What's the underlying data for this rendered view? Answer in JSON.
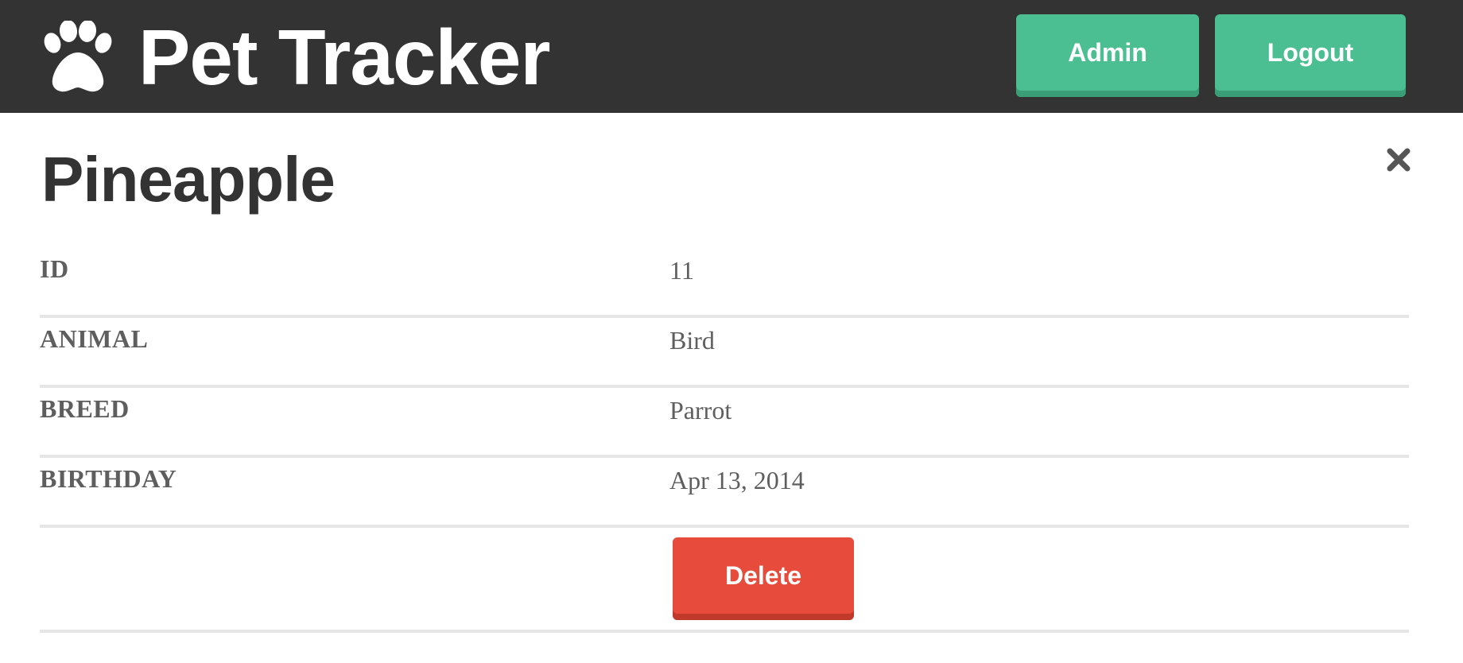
{
  "header": {
    "brand_icon": "paw-icon",
    "title": "Pet Tracker",
    "admin_label": "Admin",
    "logout_label": "Logout",
    "background_color": "#333333",
    "button_color": "#4bbf92"
  },
  "pet": {
    "name": "Pineapple",
    "close_icon": "close-icon",
    "details": [
      {
        "label": "ID",
        "value": "11"
      },
      {
        "label": "ANIMAL",
        "value": "Bird"
      },
      {
        "label": "BREED",
        "value": "Parrot"
      },
      {
        "label": "BIRTHDAY",
        "value": "Apr 13, 2014"
      }
    ],
    "delete_label": "Delete",
    "delete_color": "#e64b3c"
  }
}
